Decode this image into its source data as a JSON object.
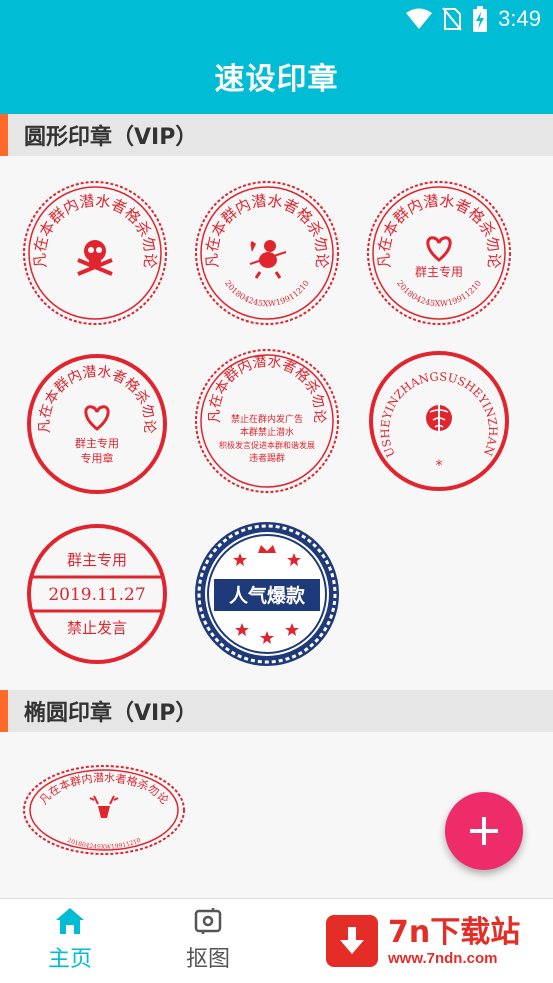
{
  "status_bar": {
    "time": "3:49",
    "icons": [
      "wifi-icon",
      "no-sim-icon",
      "battery-charging-icon"
    ]
  },
  "app_bar": {
    "title": "速设印章"
  },
  "sections": [
    {
      "label": "圆形印章（VIP）"
    },
    {
      "label": "椭圆印章（VIP）"
    }
  ],
  "stamps": {
    "arc_text": "凡在本群内潜水者格杀勿论",
    "number_text": "201804245XW19911210",
    "pinyin_text": "SUSHEYINZHANGSUSHEYINZHANG",
    "s5_center_lines": [
      "禁止在群内发广告",
      "本群禁止潜水",
      "积极发言促进本群和谐发展",
      "违者踢群"
    ],
    "s4_lines": [
      "群主专用",
      "专用章"
    ],
    "s3_line": "群主专用",
    "s7_top": "群主专用",
    "s7_date": "2019.11.27",
    "s7_bottom": "禁止发言",
    "s8_banner": "人气爆款",
    "s9_number": "20180424SXW19911210",
    "s6_star": "*",
    "red_color": "#e0252f",
    "navy_color": "#1f3a7a"
  },
  "fab": {
    "icon": "plus-icon"
  },
  "bottom_nav": [
    {
      "label": "主页",
      "icon": "home-icon",
      "active": true
    },
    {
      "label": "抠图",
      "icon": "crop-image-icon",
      "active": false
    }
  ],
  "watermark": {
    "brand": "7n下载站",
    "url": "www.7ndn.com"
  }
}
